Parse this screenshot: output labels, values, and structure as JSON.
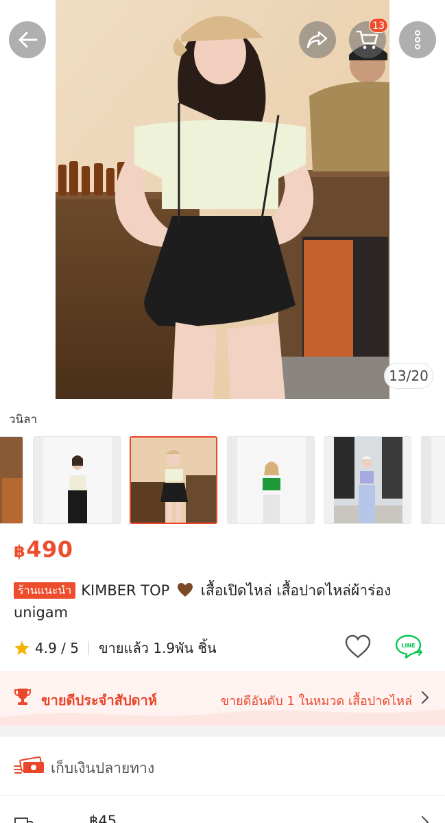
{
  "gallery": {
    "counter": "13/20",
    "cart_count": "13",
    "selected_thumb": 2
  },
  "variation_label": "วนิลา",
  "product": {
    "currency": "฿",
    "price": "490",
    "mall_tag": "ร้านแนะนำ",
    "title_part1": "KIMBER TOP",
    "title_part2": "เสื้อเปิดไหล่ เสื้อปาดไหล่ผ้าร่อง unigam",
    "rating": "4.9 / 5",
    "sold": "ขายแล้ว 1.9พัน ชิ้น",
    "line_label": "LINE"
  },
  "best_seller": {
    "title": "ขายดีประจำสัปดาห์",
    "rank_text": "ขายดีอันดับ 1 ในหมวด เสื้อปาดไหล่"
  },
  "payment": {
    "cod_text": "เก็บเงินปลายทาง"
  },
  "shipping": {
    "price": "฿45"
  },
  "colors": {
    "accent": "#ee4d2d",
    "rating_star": "#f5b400",
    "line_green": "#06c755"
  }
}
